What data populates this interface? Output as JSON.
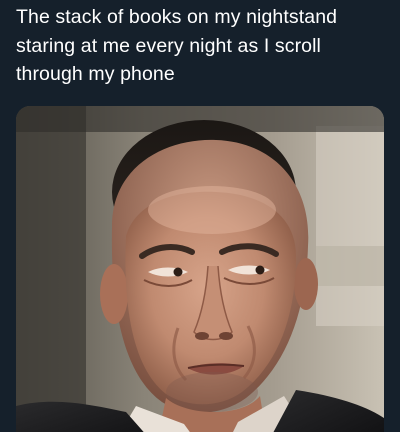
{
  "theme": {
    "background": "#15202b",
    "text_color": "#ffffff"
  },
  "tweet": {
    "text": "The stack of books on my nightstand staring at me every night as I scroll through my phone",
    "media": {
      "icon": "photo-of-man-skeptical-sideways-glance"
    }
  }
}
